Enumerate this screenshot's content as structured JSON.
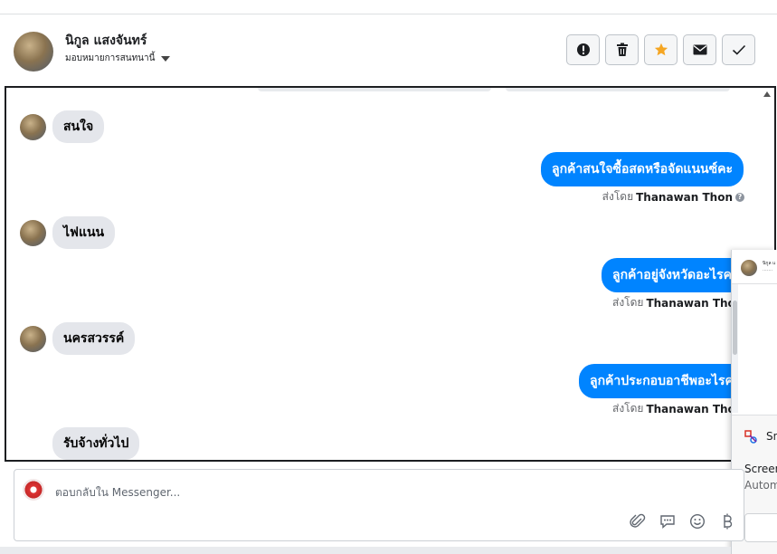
{
  "header": {
    "name": "นิกูล แสงจันทร์",
    "assign_label": "มอบหมายการสนทนานี้",
    "actions": [
      {
        "name": "spam-button",
        "icon": "alert-circle-icon"
      },
      {
        "name": "delete-button",
        "icon": "trash-icon"
      },
      {
        "name": "star-button",
        "icon": "star-icon"
      },
      {
        "name": "mark-unread-button",
        "icon": "envelope-icon"
      },
      {
        "name": "mark-done-button",
        "icon": "check-icon"
      }
    ]
  },
  "messages": {
    "in1": "สนใจ",
    "out1": "ลูกค้าสนใจซื้อสดหรือจัดแนนซ์คะ",
    "in2": "ไฟแนน",
    "out2": "ลูกค้าอยู่จังหวัดอะไรคะ",
    "in3": "นครสวรรค์",
    "out3": "ลูกค้าประกอบอาชีพอะไรคะ",
    "in4": "รับจ้างทั่วไป",
    "sent_prefix": "ส่งโดย",
    "sent_by": "Thanawan Thon"
  },
  "popup": {
    "title_short": "นิกูล แ",
    "snip_title": "Sn",
    "snip_line1": "Screen",
    "snip_line2": "Autom"
  },
  "composer": {
    "placeholder": "ตอบกลับใน Messenger..."
  },
  "colors": {
    "accent": "#0084ff",
    "star": "#f5a623"
  }
}
